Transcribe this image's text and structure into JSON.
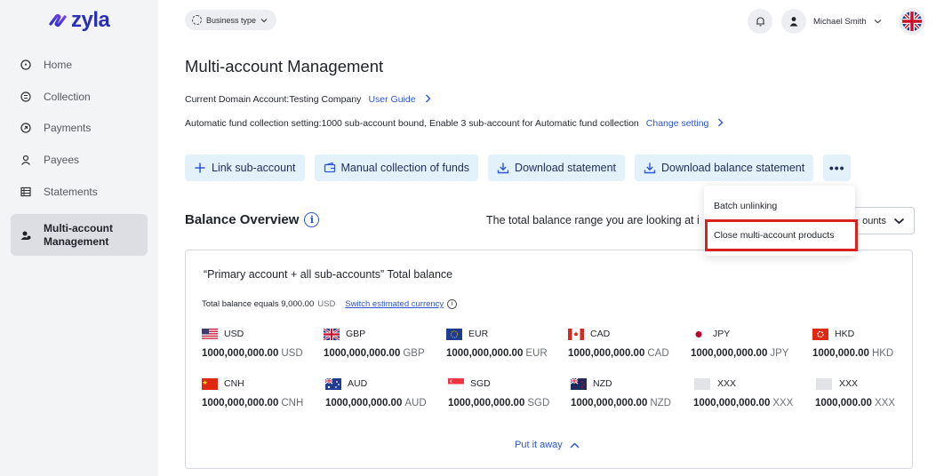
{
  "app": {
    "logo_text": "zyla"
  },
  "sidebar": {
    "items": [
      {
        "label": "Home",
        "icon": "home-icon"
      },
      {
        "label": "Collection",
        "icon": "collection-icon"
      },
      {
        "label": "Payments",
        "icon": "payments-icon"
      },
      {
        "label": "Payees",
        "icon": "payees-icon"
      },
      {
        "label": "Statements",
        "icon": "statements-icon"
      },
      {
        "label_line1": "Multi-account",
        "label_line2": "Management",
        "icon": "multi-account-icon",
        "active": true
      }
    ]
  },
  "topbar": {
    "business_type": "Business type",
    "user_name": "Michael Smith"
  },
  "page": {
    "title": "Multi-account Management",
    "domain_label": "Current Domain Account:",
    "domain_value": "Testing Company",
    "user_guide": "User Guide",
    "fund_label": "Automatic fund collection setting:",
    "fund_value": "1000 sub-account bound,  Enable 3 sub-account for Automatic fund collection",
    "change_setting": "Change setting"
  },
  "actions": {
    "link_sub": "Link sub-account",
    "manual_collection": "Manual collection of funds",
    "download_statement": "Download statement",
    "download_balance": "Download balance statement",
    "more": "•••"
  },
  "menu": {
    "batch_unlinking": "Batch unlinking",
    "close_products": "Close multi-account products"
  },
  "balance": {
    "title": "Balance Overview",
    "range_text": "The total balance range you are looking at i",
    "range_select": "ounts"
  },
  "card": {
    "title": "“Primary account + all sub-accounts” Total balance",
    "total_label": "Total balance equals 9,000.00",
    "total_unit": "USD",
    "switch_currency": "Switch estimated currency",
    "put_away": "Put it away",
    "currencies": [
      {
        "code": "USD",
        "amount": "1000,000,000.00",
        "unit": "USD",
        "flag": "us-flag"
      },
      {
        "code": "GBP",
        "amount": "1000,000,000.00",
        "unit": "GBP",
        "flag": "uk-flag"
      },
      {
        "code": "EUR",
        "amount": "1000,000,000.00",
        "unit": "EUR",
        "flag": "eu-flag"
      },
      {
        "code": "CAD",
        "amount": "1000,000,000.00",
        "unit": "CAD",
        "flag": "canada-flag"
      },
      {
        "code": "JPY",
        "amount": "1000,000,000.00",
        "unit": "JPY",
        "flag": "japan-flag"
      },
      {
        "code": "HKD",
        "amount": "1000,000.00",
        "unit": "HKD",
        "flag": "hong-kong-flag"
      },
      {
        "code": "CNH",
        "amount": "1000,000,000.00",
        "unit": "CNH",
        "flag": "china-flag"
      },
      {
        "code": "AUD",
        "amount": "1000,000,000.00",
        "unit": "AUD",
        "flag": "australia-flag"
      },
      {
        "code": "SGD",
        "amount": "1000,000,000.00",
        "unit": "SGD",
        "flag": "singapore-flag"
      },
      {
        "code": "NZD",
        "amount": "1000,000,000.00",
        "unit": "NZD",
        "flag": "new-zealand-flag"
      },
      {
        "code": "XXX",
        "amount": "1000,000,000.00",
        "unit": "XXX",
        "flag": "placeholder-flag"
      },
      {
        "code": "XXX",
        "amount": "1000,000.00",
        "unit": "XXX",
        "flag": "placeholder-flag"
      }
    ]
  },
  "colors": {
    "accent_link": "#2d55d6",
    "highlight_box": "#d9211e",
    "action_button_bg": "#e3f1fa",
    "sidebar_bg": "#f3f4f6",
    "logo": "#2a2fb8"
  }
}
